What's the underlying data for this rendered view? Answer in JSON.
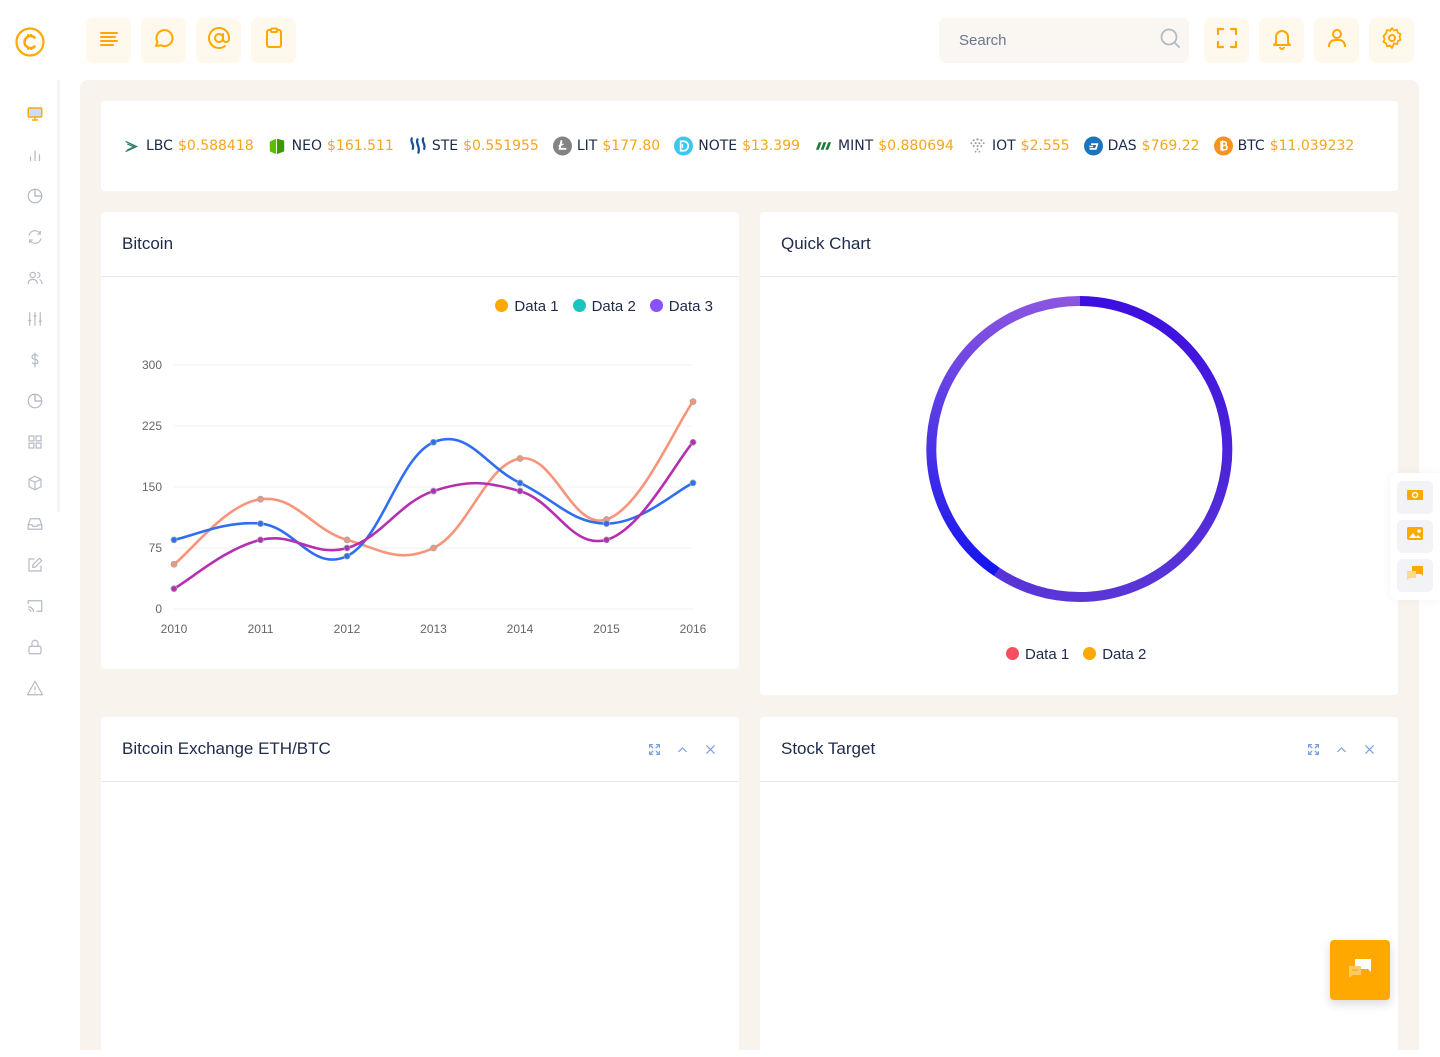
{
  "header": {
    "search_placeholder": "Search",
    "left_buttons": [
      "menu-lines",
      "chat-bubble",
      "at-sign",
      "clipboard"
    ],
    "right_buttons": [
      "fullscreen",
      "bell",
      "user",
      "gear"
    ]
  },
  "sidebar": {
    "items": [
      {
        "icon": "monitor-icon",
        "active": true
      },
      {
        "icon": "bar-chart-icon"
      },
      {
        "icon": "pie-chart-icon"
      },
      {
        "icon": "refresh-icon"
      },
      {
        "icon": "users-icon"
      },
      {
        "icon": "sliders-icon"
      },
      {
        "icon": "dollar-icon"
      },
      {
        "icon": "pie-chart-icon"
      },
      {
        "icon": "grid-icon"
      },
      {
        "icon": "box-icon"
      },
      {
        "icon": "inbox-icon"
      },
      {
        "icon": "edit-icon"
      },
      {
        "icon": "cast-icon"
      },
      {
        "icon": "lock-icon"
      },
      {
        "icon": "warning-icon"
      }
    ]
  },
  "ticker": [
    {
      "symbol": "LBC",
      "price": "$0.588418",
      "icon": "lbc-icon"
    },
    {
      "symbol": "NEO",
      "price": "$161.511",
      "icon": "neo-icon"
    },
    {
      "symbol": "STE",
      "price": "$0.551955",
      "icon": "steem-icon"
    },
    {
      "symbol": "LIT",
      "price": "$177.80",
      "icon": "litecoin-icon"
    },
    {
      "symbol": "NOTE",
      "price": "$13.399",
      "icon": "note-icon"
    },
    {
      "symbol": "MINT",
      "price": "$0.880694",
      "icon": "mint-icon"
    },
    {
      "symbol": "IOT",
      "price": "$2.555",
      "icon": "iota-icon"
    },
    {
      "symbol": "DAS",
      "price": "$769.22",
      "icon": "dash-icon"
    },
    {
      "symbol": "BTC",
      "price": "$11.039232",
      "icon": "bitcoin-icon"
    }
  ],
  "cards": {
    "bitcoin": {
      "title": "Bitcoin"
    },
    "quick_chart": {
      "title": "Quick Chart"
    },
    "exchange": {
      "title": "Bitcoin Exchange ETH/BTC"
    },
    "stock": {
      "title": "Stock Target"
    }
  },
  "colors": {
    "accent": "#ffa800",
    "price": "#f7a51c",
    "text": "#1e2a4a"
  },
  "chart_data": [
    {
      "type": "line",
      "title": "Bitcoin",
      "categories": [
        "2010",
        "2011",
        "2012",
        "2013",
        "2014",
        "2015",
        "2016"
      ],
      "series": [
        {
          "name": "Data 1",
          "legend_color": "#ffa800",
          "line_color": "#f7957a",
          "values": [
            55,
            135,
            85,
            75,
            185,
            110,
            255
          ]
        },
        {
          "name": "Data 2",
          "legend_color": "#1bc5bd",
          "line_color": "#2f6ef0",
          "values": [
            85,
            105,
            65,
            205,
            155,
            105,
            155
          ]
        },
        {
          "name": "Data 3",
          "legend_color": "#8950fc",
          "line_color": "#b52fb0",
          "values": [
            25,
            85,
            75,
            145,
            145,
            85,
            205
          ]
        }
      ],
      "yticks": [
        0,
        75,
        150,
        225,
        300
      ],
      "ylim": [
        0,
        300
      ],
      "grid": true,
      "legend": "top-right",
      "xlabel": "",
      "ylabel": ""
    },
    {
      "type": "pie",
      "title": "Quick Chart",
      "style": "donut-ring",
      "series": [
        {
          "name": "Data 1",
          "legend_color": "#f64e60"
        },
        {
          "name": "Data 2",
          "legend_color": "#ffa800"
        }
      ],
      "legend": "bottom"
    }
  ]
}
